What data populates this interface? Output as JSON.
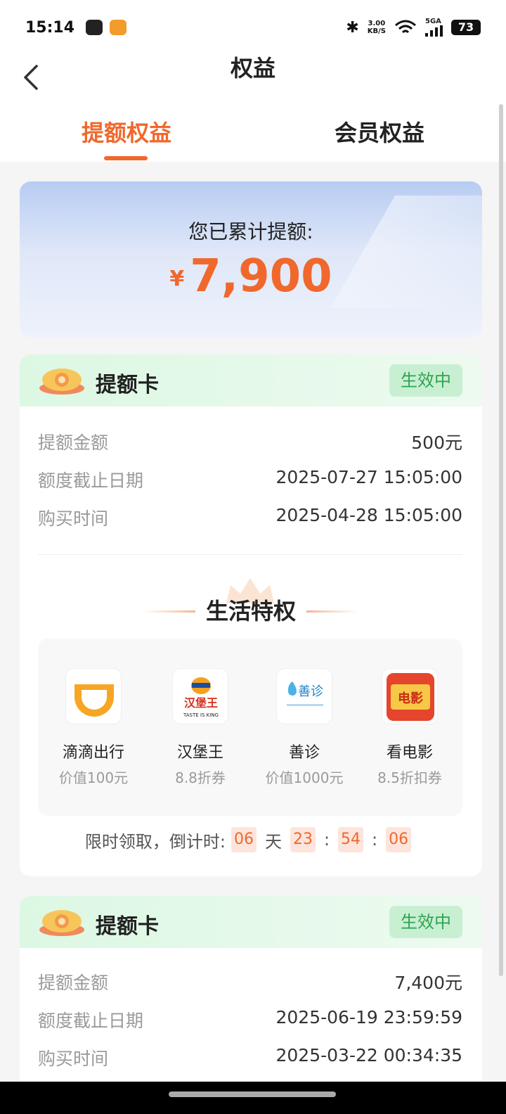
{
  "status_bar": {
    "time": "15:14",
    "network_speed_value": "3.00",
    "network_speed_unit": "KB/S",
    "network_type": "5GA",
    "battery": "73"
  },
  "nav": {
    "title": "权益"
  },
  "tabs": [
    {
      "label": "提额权益",
      "active": true
    },
    {
      "label": "会员权益",
      "active": false
    }
  ],
  "summary": {
    "label": "您已累计提额:",
    "currency": "¥",
    "amount": "7,900"
  },
  "cards": [
    {
      "title": "提额卡",
      "status": "生效中",
      "rows": [
        {
          "label": "提额金额",
          "value": "500元"
        },
        {
          "label": "额度截止日期",
          "value": "2025-07-27 15:05:00"
        },
        {
          "label": "购买时间",
          "value": "2025-04-28 15:05:00"
        }
      ],
      "perks_title": "生活特权",
      "perks": [
        {
          "name": "滴滴出行",
          "sub": "价值100元",
          "icon": "didi-icon"
        },
        {
          "name": "汉堡王",
          "sub": "8.8折券",
          "icon": "burger-king-icon",
          "logo_text": "汉堡王",
          "logo_sub": "TASTE IS KING"
        },
        {
          "name": "善诊",
          "sub": "价值1000元",
          "icon": "shanzhen-icon",
          "logo_text": "善诊"
        },
        {
          "name": "看电影",
          "sub": "8.5折扣券",
          "icon": "movie-icon",
          "logo_text": "电影"
        }
      ],
      "countdown": {
        "label": "限时领取，倒计时:",
        "days": "06",
        "day_unit": "天",
        "hours": "23",
        "minutes": "54",
        "seconds": "06",
        "separator": ":"
      }
    },
    {
      "title": "提额卡",
      "status": "生效中",
      "rows": [
        {
          "label": "提额金额",
          "value": "7,400元"
        },
        {
          "label": "额度截止日期",
          "value": "2025-06-19 23:59:59"
        },
        {
          "label": "购买时间",
          "value": "2025-03-22 00:34:35"
        }
      ]
    }
  ],
  "colors": {
    "accent": "#f0682c",
    "status_green": "#2ea44f",
    "badge_bg": "#c9efd3"
  }
}
